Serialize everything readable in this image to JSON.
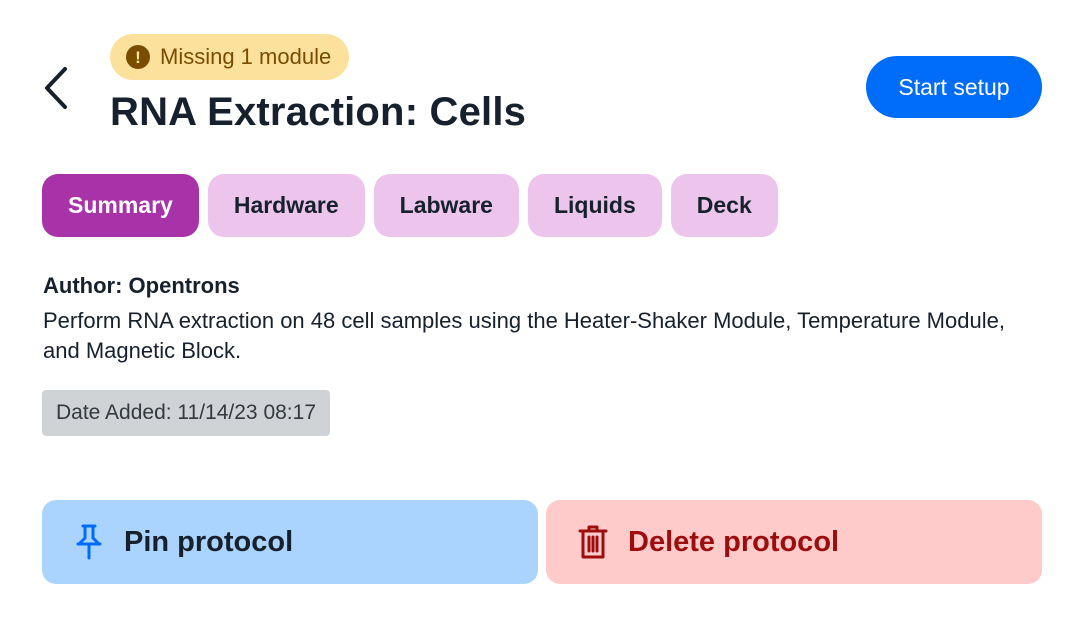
{
  "header": {
    "badge_text": "Missing 1 module",
    "title": "RNA Extraction: Cells",
    "start_button": "Start setup"
  },
  "tabs": [
    {
      "label": "Summary",
      "active": true
    },
    {
      "label": "Hardware",
      "active": false
    },
    {
      "label": "Labware",
      "active": false
    },
    {
      "label": "Liquids",
      "active": false
    },
    {
      "label": "Deck",
      "active": false
    }
  ],
  "summary": {
    "author": "Author: Opentrons",
    "description": "Perform RNA extraction on 48 cell samples using the Heater-Shaker Module, Temperature Module, and Magnetic Block.",
    "date_added": "Date Added: 11/14/23 08:17"
  },
  "actions": {
    "pin_label": "Pin protocol",
    "delete_label": "Delete protocol"
  },
  "colors": {
    "accent_blue": "#006cfa",
    "tab_active": "#a833a8",
    "tab_inactive": "#edc5ec",
    "warning_bg": "#fbe19b",
    "pin_bg": "#aad4fe",
    "delete_bg": "#ffcaca",
    "delete_text": "#9e0d0d"
  },
  "icons": {
    "back": "chevron-left-icon",
    "warning": "warning-icon",
    "pin": "pin-icon",
    "delete": "trash-icon"
  }
}
